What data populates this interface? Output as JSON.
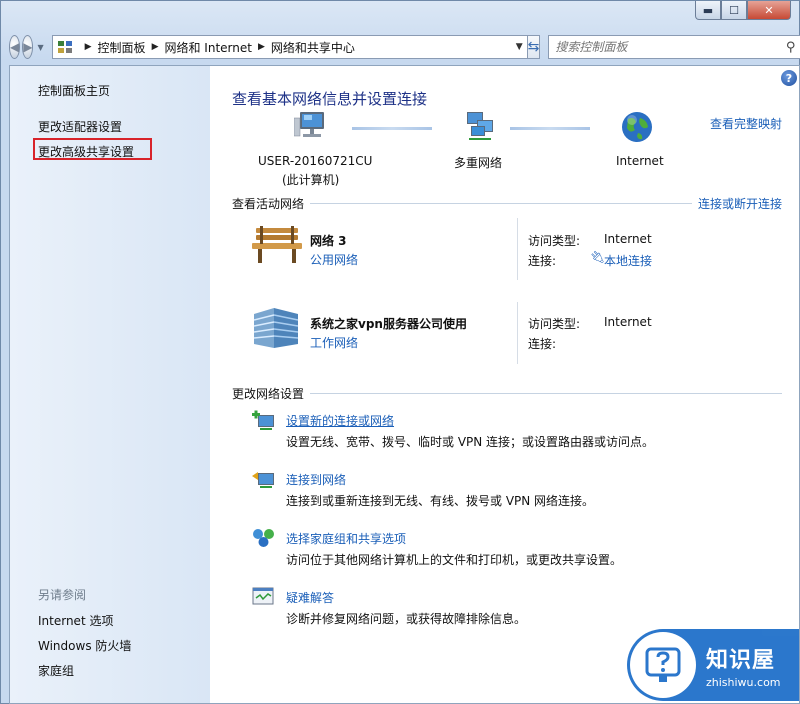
{
  "window": {
    "caption_min": "▬",
    "caption_max": "☐",
    "caption_close": "✕"
  },
  "nav": {
    "back_icon": "back-arrow-icon",
    "forward_icon": "forward-arrow-icon",
    "breadcrumb": [
      "控制面板",
      "网络和 Internet",
      "网络和共享中心"
    ],
    "search_placeholder": "搜索控制面板"
  },
  "sidebar": {
    "home": "控制面板主页",
    "adapter": "更改适配器设置",
    "advanced": "更改高级共享设置",
    "see_also": "另请参阅",
    "links": [
      "Internet 选项",
      "Windows 防火墙",
      "家庭组"
    ]
  },
  "main": {
    "title": "查看基本网络信息并设置连接",
    "full_map": "查看完整映射",
    "nodes": [
      {
        "label": "USER-20160721CU",
        "sub": "(此计算机)",
        "icon": "computer-icon"
      },
      {
        "label": "多重网络",
        "sub": "",
        "icon": "network-icon"
      },
      {
        "label": "Internet",
        "sub": "",
        "icon": "globe-icon"
      }
    ],
    "active_title": "查看活动网络",
    "connect_disconnect": "连接或断开连接",
    "networks": [
      {
        "name": "网络  3",
        "type_link": "公用网络",
        "icon": "bench-icon",
        "access_label": "访问类型:",
        "access_value": "Internet",
        "conn_label": "连接:",
        "conn_value": "本地连接"
      },
      {
        "name": "系统之家vpn服务器公司使用",
        "type_link": "工作网络",
        "icon": "building-icon",
        "access_label": "访问类型:",
        "access_value": "Internet",
        "conn_label": "连接:",
        "conn_value": ""
      }
    ],
    "change_title": "更改网络设置",
    "tasks": [
      {
        "link": "设置新的连接或网络",
        "desc": "设置无线、宽带、拨号、临时或 VPN 连接；或设置路由器或访问点。"
      },
      {
        "link": "连接到网络",
        "desc": "连接到或重新连接到无线、有线、拨号或 VPN 网络连接。"
      },
      {
        "link": "选择家庭组和共享选项",
        "desc": "访问位于其他网络计算机上的文件和打印机，或更改共享设置。"
      },
      {
        "link": "疑难解答",
        "desc": "诊断并修复网络问题，或获得故障排除信息。"
      }
    ]
  },
  "watermark": {
    "cn": "知识屋",
    "en": "zhishiwu.com"
  },
  "colors": {
    "link": "#1b5fb8",
    "title": "#1e3287",
    "highlight": "#d8232a",
    "sidebar": "#dfe9f6"
  }
}
